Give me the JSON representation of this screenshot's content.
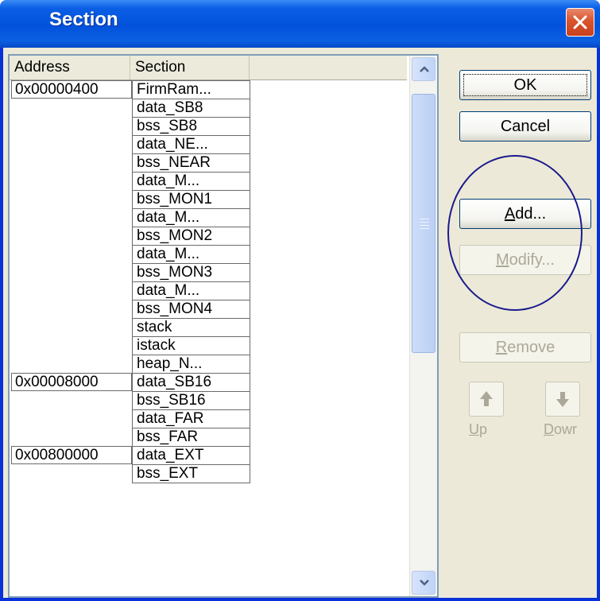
{
  "window": {
    "title": "Section"
  },
  "list": {
    "columns": [
      "Address",
      "Section"
    ],
    "rows": [
      {
        "address": "0x00000400",
        "section": "FirmRam..."
      },
      {
        "address": "",
        "section": "data_SB8"
      },
      {
        "address": "",
        "section": "bss_SB8"
      },
      {
        "address": "",
        "section": "data_NE..."
      },
      {
        "address": "",
        "section": "bss_NEAR"
      },
      {
        "address": "",
        "section": "data_M..."
      },
      {
        "address": "",
        "section": "bss_MON1"
      },
      {
        "address": "",
        "section": "data_M..."
      },
      {
        "address": "",
        "section": "bss_MON2"
      },
      {
        "address": "",
        "section": "data_M..."
      },
      {
        "address": "",
        "section": "bss_MON3"
      },
      {
        "address": "",
        "section": "data_M..."
      },
      {
        "address": "",
        "section": "bss_MON4"
      },
      {
        "address": "",
        "section": "stack"
      },
      {
        "address": "",
        "section": "istack"
      },
      {
        "address": "",
        "section": "heap_N..."
      },
      {
        "address": "0x00008000",
        "section": "data_SB16"
      },
      {
        "address": "",
        "section": "bss_SB16"
      },
      {
        "address": "",
        "section": "data_FAR"
      },
      {
        "address": "",
        "section": "bss_FAR"
      },
      {
        "address": "0x00800000",
        "section": "data_EXT"
      },
      {
        "address": "",
        "section": "bss_EXT"
      }
    ]
  },
  "buttons": {
    "ok": "OK",
    "cancel": "Cancel",
    "add_u": "A",
    "add_rest": "dd...",
    "modify_u": "M",
    "modify_rest": "odify...",
    "remove_u": "R",
    "remove_rest": "emove",
    "up_u": "U",
    "up_rest": "p",
    "down_u": "D",
    "down_rest": "owr"
  },
  "colors": {
    "titlebar": "#0a5ee4",
    "annotation": "#1a1a8c",
    "disabled_text": "#aca899"
  },
  "icons": {
    "close": "close-icon",
    "scroll_up": "scroll-up-arrow-icon",
    "scroll_down": "scroll-down-arrow-icon",
    "move_up": "up-arrow-icon",
    "move_down": "down-arrow-icon"
  }
}
